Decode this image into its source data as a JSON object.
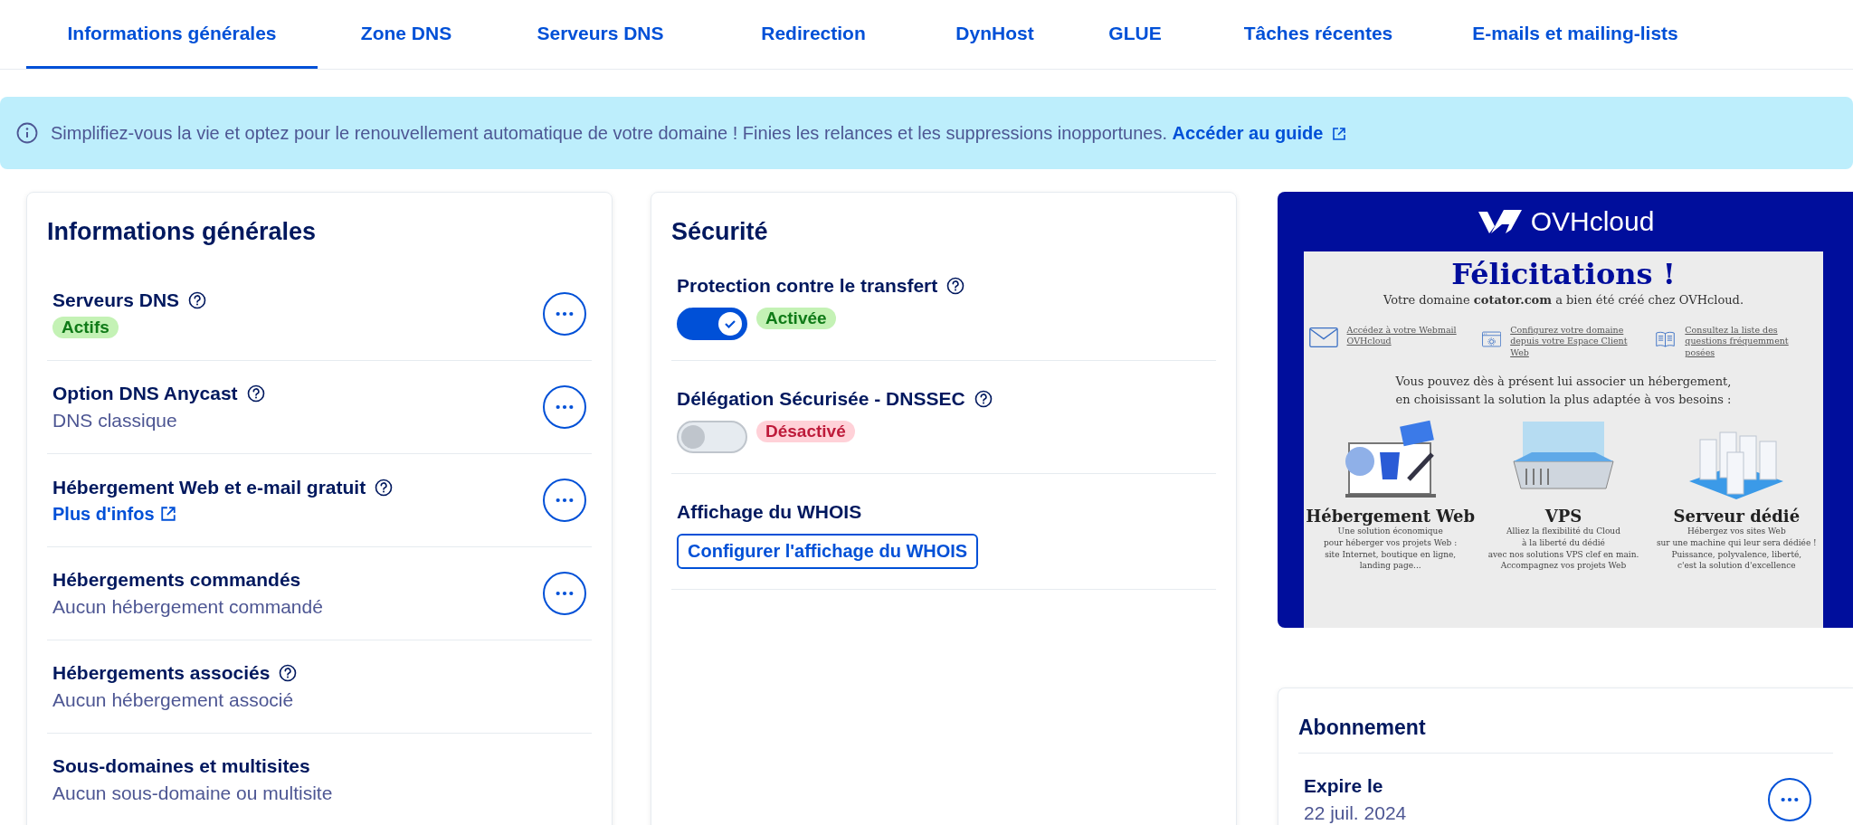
{
  "tabs": [
    {
      "label": "Informations générales",
      "selected": true
    },
    {
      "label": "Zone DNS",
      "selected": false
    },
    {
      "label": "Serveurs DNS",
      "selected": false
    },
    {
      "label": "Redirection",
      "selected": false
    },
    {
      "label": "DynHost",
      "selected": false
    },
    {
      "label": "GLUE",
      "selected": false
    },
    {
      "label": "Tâches récentes",
      "selected": false
    },
    {
      "label": "E-mails et mailing-lists",
      "selected": false
    }
  ],
  "banner": {
    "text": "Simplifiez-vous la vie et optez pour le renouvellement automatique de votre domaine ! Finies les relances et les suppressions inopportunes.",
    "link": "Accéder au guide"
  },
  "general_info": {
    "title": "Informations générales",
    "rows": [
      {
        "label": "Serveurs DNS",
        "help": true,
        "kind": "badge",
        "value": "Actifs",
        "action": true
      },
      {
        "label": "Option DNS Anycast",
        "help": true,
        "kind": "text",
        "value": "DNS classique",
        "action": true
      },
      {
        "label": "Hébergement Web et e-mail gratuit",
        "help": true,
        "kind": "link",
        "value": "Plus d'infos",
        "action": true
      },
      {
        "label": "Hébergements commandés",
        "help": false,
        "kind": "text",
        "value": "Aucun hébergement commandé",
        "action": true
      },
      {
        "label": "Hébergements associés",
        "help": true,
        "kind": "text",
        "value": "Aucun hébergement associé",
        "action": false
      },
      {
        "label": "Sous-domaines et multisites",
        "help": false,
        "kind": "text",
        "value": "Aucun sous-domaine ou multisite",
        "action": false
      }
    ]
  },
  "security": {
    "title": "Sécurité",
    "items": [
      {
        "kind": "toggle",
        "label": "Protection contre le transfert",
        "help": true,
        "on": true,
        "status": "Activée"
      },
      {
        "kind": "toggle",
        "label": "Délégation Sécurisée - DNSSEC",
        "help": true,
        "on": false,
        "status": "Désactivé"
      },
      {
        "kind": "button",
        "label": "Affichage du WHOIS",
        "help": false,
        "button": "Configurer l'affichage du WHOIS"
      }
    ]
  },
  "promo": {
    "logo": "OVHcloud",
    "heading": "Félicitations !",
    "subtitle": "Votre domaine **cotator.com** a bien été créé chez OVHcloud.",
    "links": [
      {
        "kind": "mail",
        "text": "Accédez à votre Webmail OVHcloud"
      },
      {
        "kind": "config",
        "text": "Configurez votre domaine depuis votre Espace Client Web"
      },
      {
        "kind": "book",
        "text": "Consultez la liste des questions fréquemment posées"
      }
    ],
    "intro": [
      "Vous pouvez dès à présent lui associer un hébergement,",
      "en choisissant la solution la plus adaptée à vos besoins :"
    ],
    "products": [
      {
        "kind": "web",
        "name": "Hébergement Web",
        "lines": [
          "Une solution économique",
          "pour héberger vos projets Web :",
          "site Internet, boutique en ligne,",
          "landing page..."
        ]
      },
      {
        "kind": "vps",
        "name": "VPS",
        "lines": [
          "Alliez la flexibilité du Cloud",
          "à la liberté du dédié",
          "avec nos solutions VPS clef en main.",
          "Accompagnez vos projets Web"
        ]
      },
      {
        "kind": "dedicated",
        "name": "Serveur dédié",
        "lines": [
          "Hébergez vos sites Web",
          "sur une machine qui leur sera dédiée !",
          "Puissance, polyvalence, liberté,",
          "c'est la solution d'excellence"
        ]
      }
    ]
  },
  "subscription": {
    "title": "Abonnement",
    "rows": [
      {
        "label": "Expire le",
        "value": "22 juil. 2024",
        "action": true
      }
    ]
  }
}
